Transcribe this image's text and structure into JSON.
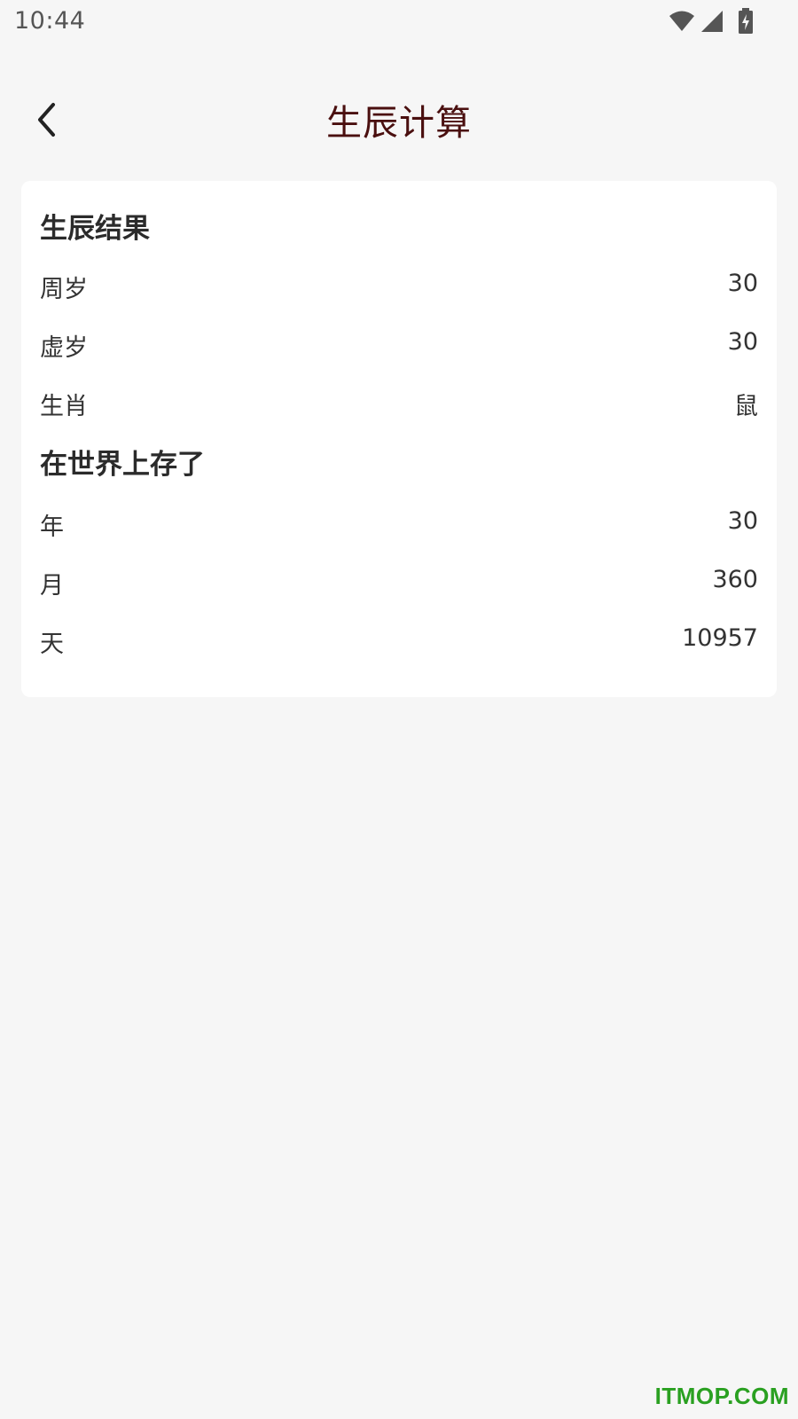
{
  "status_bar": {
    "time": "10:44",
    "icons": [
      "wifi-icon",
      "signal-icon",
      "battery-charging-icon"
    ]
  },
  "header": {
    "back_icon": "chevron-left-icon",
    "title": "生辰计算",
    "title_color": "#4a0f0f"
  },
  "result": {
    "title": "生辰结果",
    "rows": [
      {
        "label": "周岁",
        "value": "30"
      },
      {
        "label": "虚岁",
        "value": "30"
      },
      {
        "label": "生肖",
        "value": "鼠"
      }
    ]
  },
  "lived": {
    "title": "在世界上存了",
    "rows": [
      {
        "label": "年",
        "value": "30"
      },
      {
        "label": "月",
        "value": "360"
      },
      {
        "label": "天",
        "value": "10957"
      }
    ]
  },
  "watermark": {
    "text": "ITMOP.COM",
    "color": "#2aa021"
  }
}
